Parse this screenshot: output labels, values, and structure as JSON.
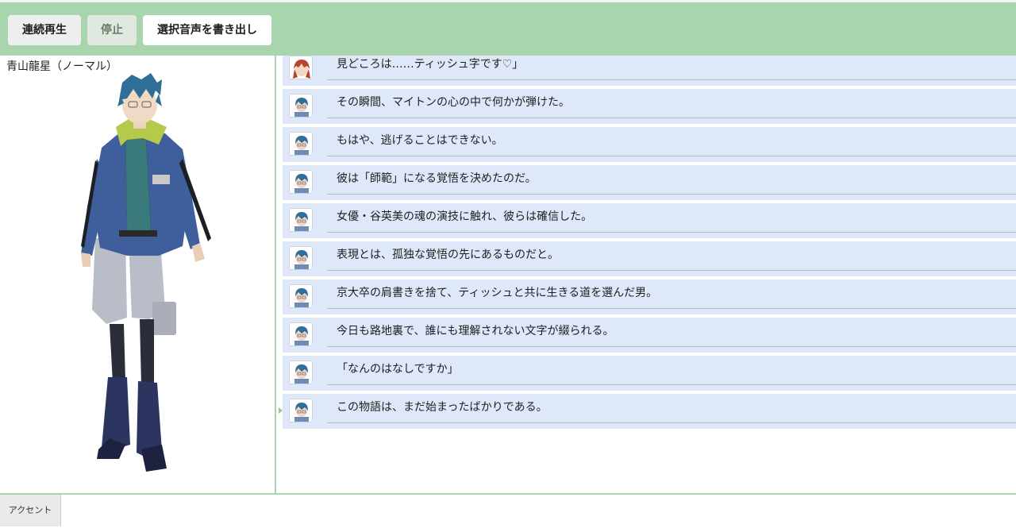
{
  "toolbar": {
    "play_label": "連続再生",
    "stop_label": "停止",
    "export_label": "選択音声を書き出し"
  },
  "character": {
    "name": "青山龍星（ノーマル）"
  },
  "dialogue": [
    {
      "speaker_icon": "red-hair-avatar-icon",
      "text": "見どころは……ティッシュ字です♡」"
    },
    {
      "speaker_icon": "blue-hair-avatar-icon",
      "text": "その瞬間、マイトンの心の中で何かが弾けた。"
    },
    {
      "speaker_icon": "blue-hair-avatar-icon",
      "text": "もはや、逃げることはできない。"
    },
    {
      "speaker_icon": "blue-hair-avatar-icon",
      "text": "彼は「師範」になる覚悟を決めたのだ。"
    },
    {
      "speaker_icon": "blue-hair-avatar-icon",
      "text": "女優・谷英美の魂の演技に触れ、彼らは確信した。"
    },
    {
      "speaker_icon": "blue-hair-avatar-icon",
      "text": "表現とは、孤独な覚悟の先にあるものだと。"
    },
    {
      "speaker_icon": "blue-hair-avatar-icon",
      "text": "京大卒の肩書きを捨て、ティッシュと共に生きる道を選んだ男。"
    },
    {
      "speaker_icon": "blue-hair-avatar-icon",
      "text": "今日も路地裏で、誰にも理解されない文字が綴られる。"
    },
    {
      "speaker_icon": "blue-hair-avatar-icon",
      "text": "「なんのはなしですか」"
    },
    {
      "speaker_icon": "blue-hair-avatar-icon",
      "text": "この物語は、まだ始まったばかりである。"
    }
  ],
  "bottom": {
    "accent_label": "アクセント"
  },
  "colors": {
    "toolbar_bg": "#a8d5ae",
    "row_bg": "#dfe8f8",
    "accent_border": "#a8d5ae"
  }
}
